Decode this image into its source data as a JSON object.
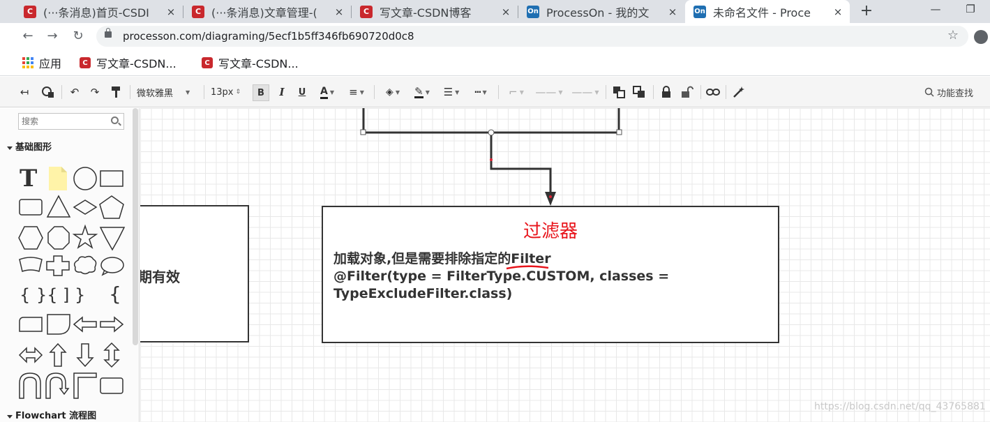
{
  "browser": {
    "tabs": [
      {
        "title": "(···条消息)首页-CSDI",
        "favicon": "csdn-icon",
        "active": false
      },
      {
        "title": "(···条消息)文章管理-(",
        "favicon": "csdn-icon",
        "active": false
      },
      {
        "title": "写文章-CSDN博客",
        "favicon": "csdn-icon",
        "active": false
      },
      {
        "title": "ProcessOn - 我的文",
        "favicon": "processon-icon",
        "active": false
      },
      {
        "title": "未命名文件 - Proce",
        "favicon": "processon-icon",
        "active": true
      }
    ],
    "close_glyph": "×",
    "new_tab": "+",
    "url": "processon.com/diagraming/5ecf1b5ff346fb690720d0c8",
    "bookmarks": [
      {
        "label": "应用",
        "icon": "apps-icon"
      },
      {
        "label": "写文章-CSDN...",
        "icon": "csdn-icon"
      },
      {
        "label": "写文章-CSDN...",
        "icon": "csdn-icon"
      }
    ],
    "favicon_on": "On"
  },
  "toolbar": {
    "font": "微软雅黑",
    "size": "13px",
    "bold": "B",
    "italic": "I",
    "underline": "U",
    "font_color": "A",
    "func_search": "功能查找"
  },
  "sidebar": {
    "search_placeholder": "搜索",
    "section_basic": "基础图形",
    "section_flowchart": "Flowchart 流程图"
  },
  "canvas": {
    "filter_node": {
      "title": "过滤器",
      "line1_prefix": "加载对象,但是需要排除指定的",
      "line1_highlight": "Filter",
      "line2": "@Filter(type = FilterType.CUSTOM, classes =",
      "line3": "TypeExcludeFilter.class)"
    },
    "left_node_text": "期有效",
    "watermark": "https://blog.csdn.net/qq_43765881"
  },
  "colors": {
    "title_red": "#e8141b",
    "csdn_red": "#c9282d",
    "processon_blue": "#1f6fb2"
  }
}
